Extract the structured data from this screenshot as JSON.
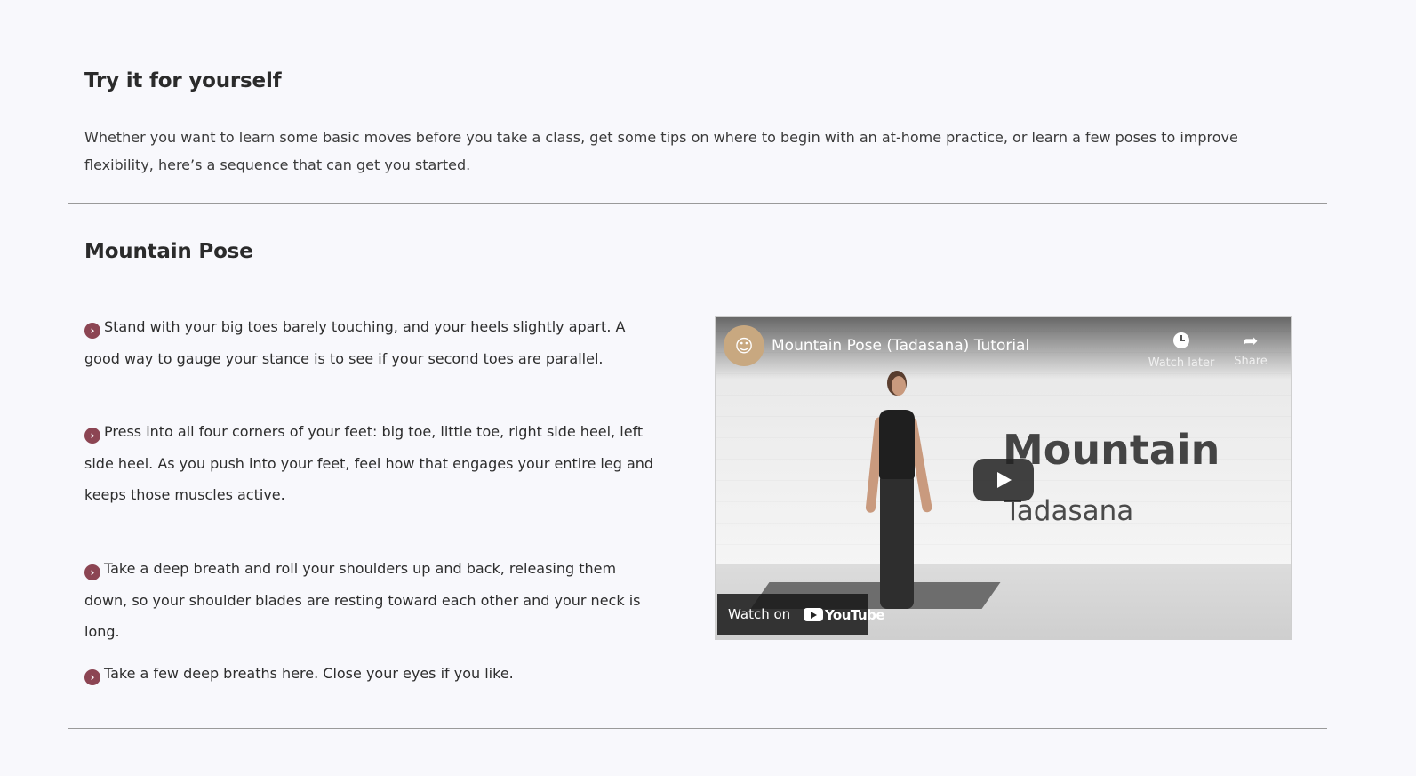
{
  "intro": {
    "title": "Try it for yourself",
    "text": "Whether you want to learn some basic moves before you take a class, get some tips on where to begin with an at-home practice, or learn a few poses to improve flexibility, here’s a sequence that can get you started."
  },
  "pose": {
    "title": "Mountain Pose",
    "steps": [
      {
        "text": "Stand with your big toes barely touching, and your heels slightly apart. A good way to gauge your stance is to see if your second toes are parallel."
      },
      {
        "text": "Press into all four corners of your feet: big toe, little toe, right side heel, left side heel. As you push into your feet, feel how that engages your entire leg and keeps those muscles active."
      },
      {
        "text": "Take a deep breath and roll your shoulders up and back, releasing them down, so your shoulder blades are resting toward each other and your neck is long."
      },
      {
        "text": "Take a few deep breaths here. Close your eyes if you like."
      }
    ],
    "bullet_icon": "chevron-right-circle-icon",
    "bullet_color": "#8c4553"
  },
  "video": {
    "title": "Mountain Pose (Tadasana) Tutorial",
    "watch_later_label": "Watch later",
    "share_label": "Share",
    "overlay_title": "Mountain",
    "overlay_subtitle": "Tadasana",
    "watch_on_label": "Watch on",
    "platform_name": "YouTube",
    "icons": {
      "channel": "channel-avatar-icon",
      "watch_later": "clock-icon",
      "share": "share-arrow-icon",
      "play": "play-icon"
    }
  }
}
